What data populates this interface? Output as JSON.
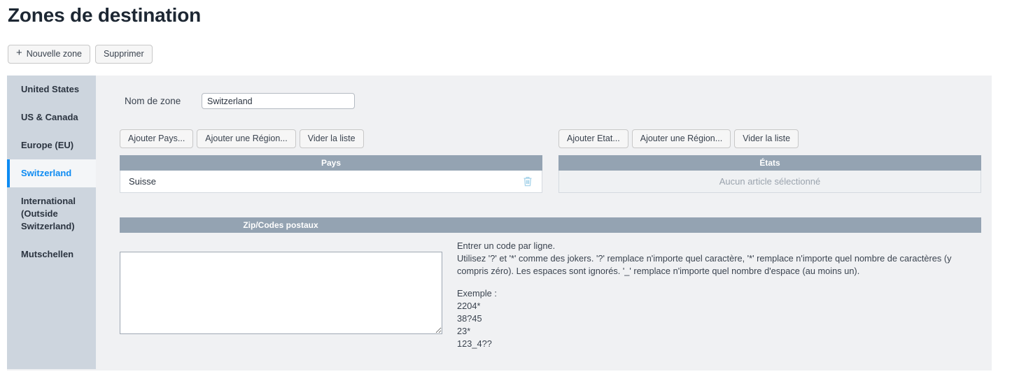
{
  "page": {
    "title": "Zones de destination"
  },
  "toolbar": {
    "new_zone_label": "Nouvelle zone",
    "new_zone_icon": "plus-icon",
    "delete_label": "Supprimer"
  },
  "sidebar": {
    "items": [
      {
        "label": "United States",
        "active": false
      },
      {
        "label": "US & Canada",
        "active": false
      },
      {
        "label": "Europe (EU)",
        "active": false
      },
      {
        "label": "Switzerland",
        "active": true
      },
      {
        "label": "International (Outside Switzerland)",
        "active": false
      },
      {
        "label": "Mutschellen",
        "active": false
      }
    ]
  },
  "form": {
    "zone_name_label": "Nom de zone",
    "zone_name_value": "Switzerland",
    "zone_name_placeholder": ""
  },
  "countries_panel": {
    "buttons": {
      "add": "Ajouter Pays...",
      "add_region": "Ajouter une Région...",
      "clear": "Vider la liste"
    },
    "header": "Pays",
    "rows": [
      {
        "name": "Suisse",
        "delete_icon": "trash-icon"
      }
    ]
  },
  "states_panel": {
    "buttons": {
      "add": "Ajouter Etat...",
      "add_region": "Ajouter une Région...",
      "clear": "Vider la liste"
    },
    "header": "États",
    "empty_text": "Aucun article sélectionné"
  },
  "zip_panel": {
    "header": "Zip/Codes postaux",
    "textarea_value": "",
    "textarea_placeholder": "",
    "help_line_1": "Entrer un code par ligne.",
    "help_line_2": "Utilisez '?' et '*' comme des jokers. '?' remplace n'importe quel caractère, '*' remplace n'importe quel nombre de caractères (y compris zéro). Les espaces sont ignorés. '_' remplace n'importe quel nombre d'espace (au moins un).",
    "example_label": "Exemple :",
    "examples": [
      "2204*",
      "38?45",
      "23*",
      "123_4??"
    ]
  },
  "colors": {
    "accent": "#0d8bf2",
    "sidebar_bg": "#cdd5de",
    "panel_bg": "#f0f1f3",
    "table_header": "#94a3b2",
    "trash": "#a8d4ea"
  }
}
